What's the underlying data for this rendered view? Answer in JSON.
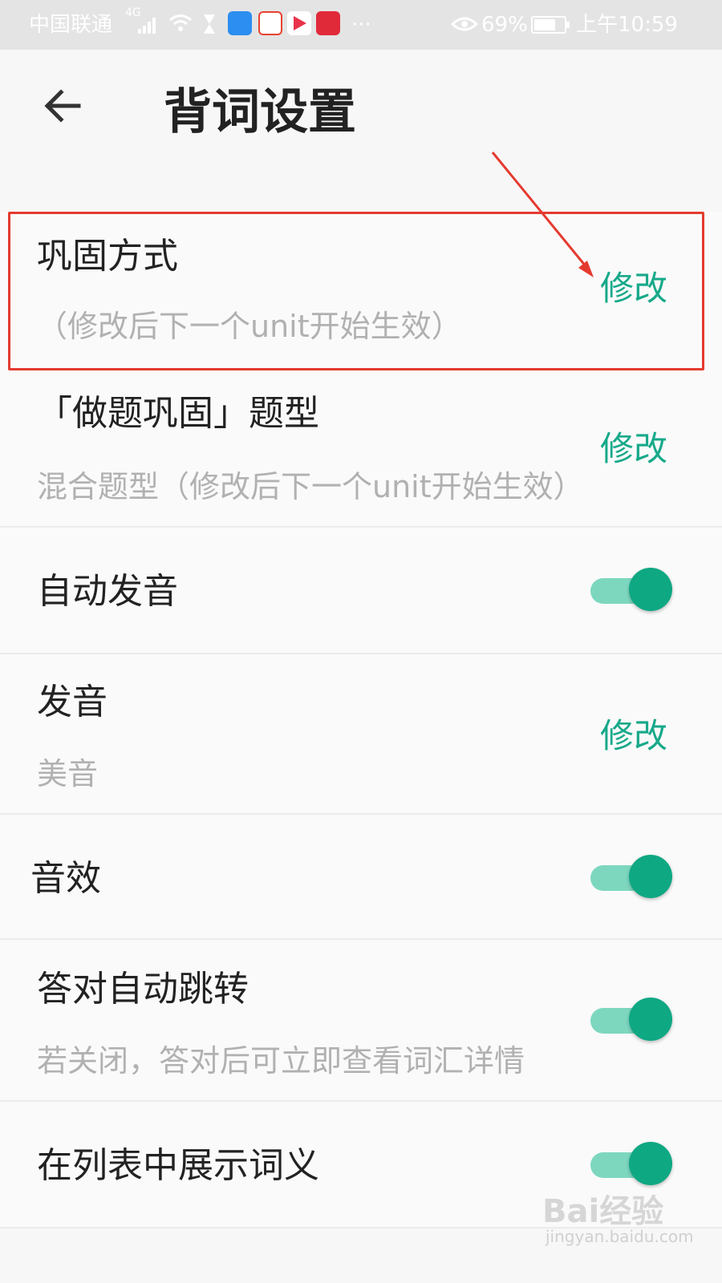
{
  "status_bar": {
    "carrier": "中国联通",
    "network": "4G",
    "dots": "···",
    "battery": "69%",
    "time": "上午10:59"
  },
  "header": {
    "title": "背词设置"
  },
  "settings": [
    {
      "title": "巩固方式",
      "subtitle": "（修改后下一个unit开始生效）",
      "action": "修改"
    },
    {
      "title": "「做题巩固」题型",
      "subtitle": "混合题型（修改后下一个unit开始生效）",
      "action": "修改"
    },
    {
      "title": "自动发音",
      "toggle_on": true
    },
    {
      "title": "发音",
      "subtitle": "美音",
      "action": "修改"
    },
    {
      "title": "音效",
      "toggle_on": true
    },
    {
      "title": "答对自动跳转",
      "subtitle": "若关闭，答对后可立即查看词汇详情",
      "toggle_on": true
    },
    {
      "title": "在列表中展示词义",
      "toggle_on": true
    }
  ],
  "colors": {
    "accent": "#17a98a",
    "toggle_track": "#7dd7bf",
    "toggle_knob": "#0ea883",
    "annotation": "#e53a2f"
  },
  "watermark": {
    "text": "Bai经验",
    "sub": "jingyan.baidu.com"
  }
}
